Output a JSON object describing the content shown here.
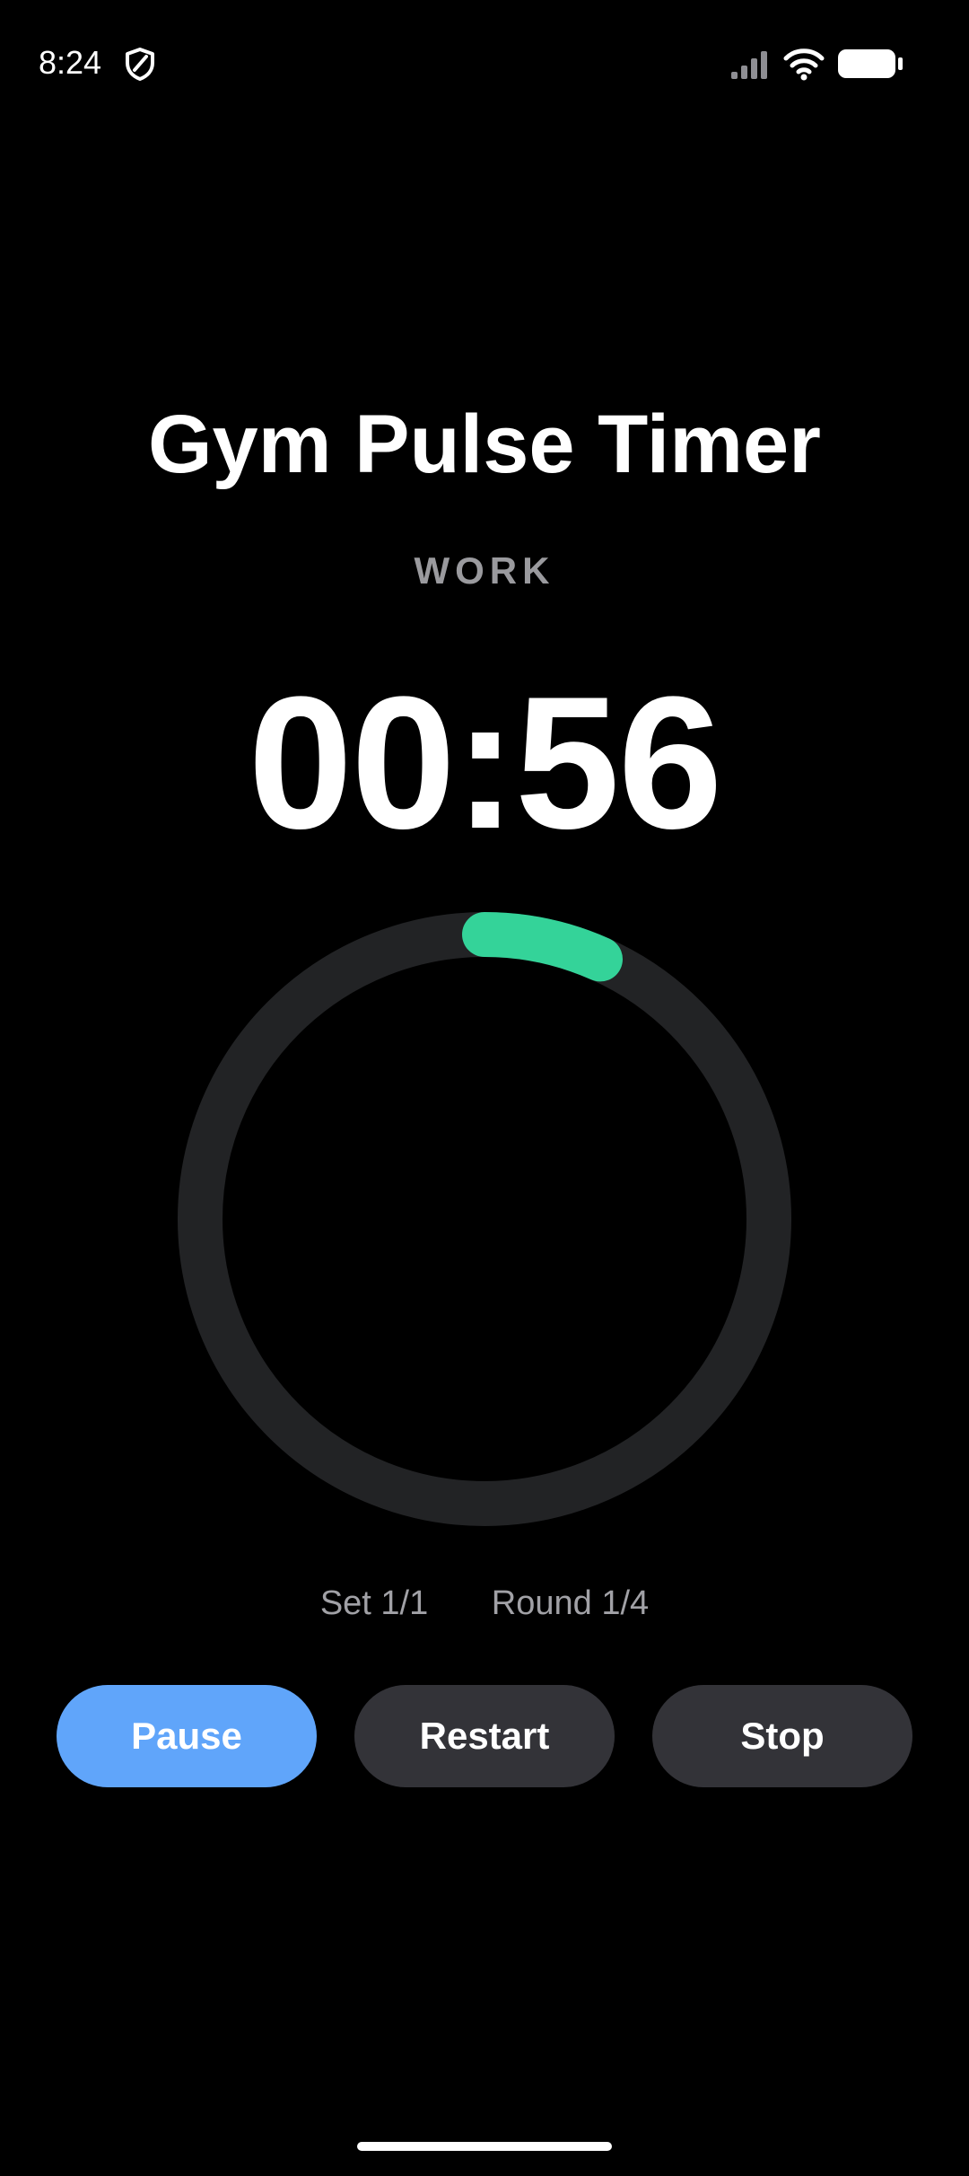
{
  "status_bar": {
    "time": "8:24",
    "icons": [
      "shield-icon",
      "signal-icon",
      "wifi-icon",
      "battery-icon"
    ]
  },
  "app": {
    "title": "Gym Pulse Timer",
    "phase": "WORK",
    "time_remaining": "00:56"
  },
  "progress": {
    "fraction": 0.0667,
    "track_color": "#222325",
    "fill_color": "#34d399"
  },
  "counters": {
    "set": "Set 1/1",
    "round": "Round 1/4"
  },
  "controls": {
    "pause_label": "Pause",
    "restart_label": "Restart",
    "stop_label": "Stop",
    "pause_color": "#60a5fa",
    "secondary_color": "#333338"
  }
}
